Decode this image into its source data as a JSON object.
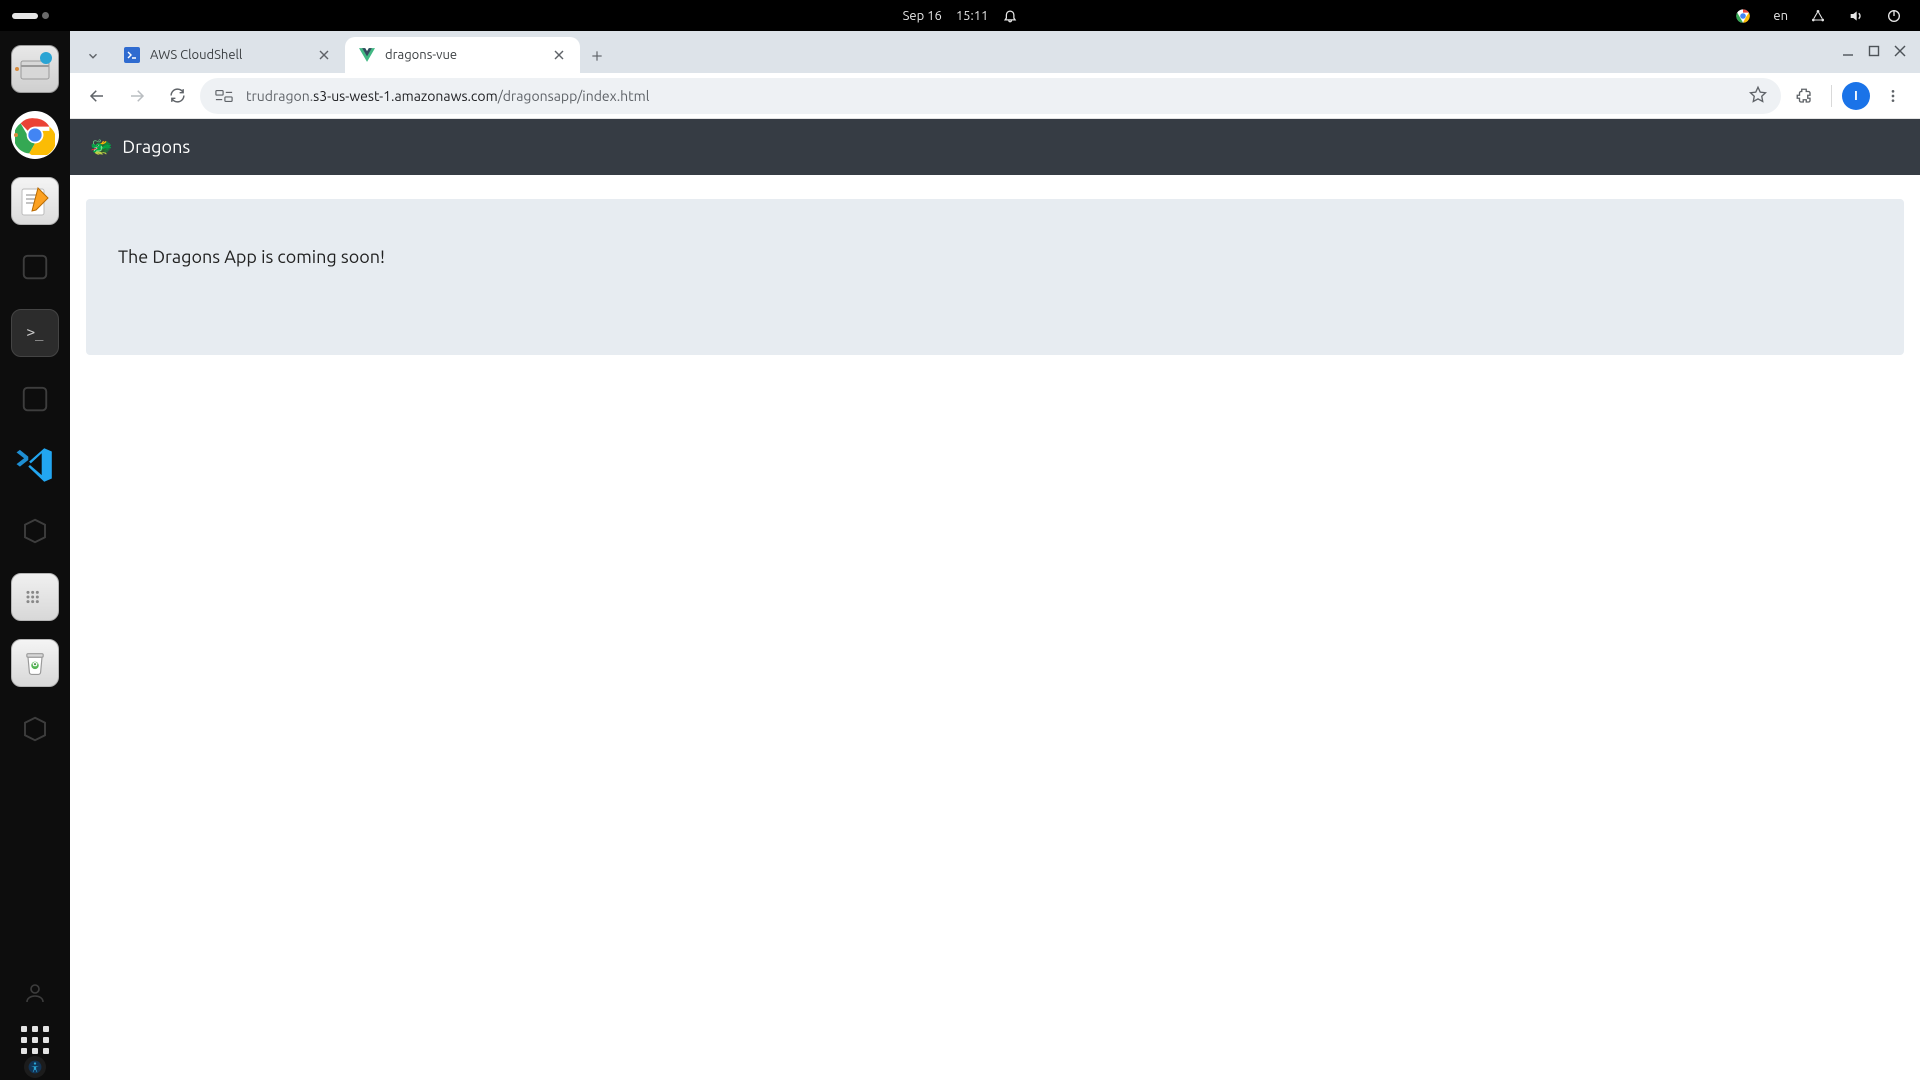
{
  "system": {
    "date": "Sep 16",
    "time": "15:11",
    "lang": "en"
  },
  "dock": {
    "files_badge": "1",
    "term_label": ">_"
  },
  "browser": {
    "tabs": [
      {
        "label": "AWS CloudShell",
        "active": false
      },
      {
        "label": "dragons-vue",
        "active": true
      }
    ],
    "url_host_prefix": "trudragon.",
    "url_host_main": "s3-us-west-1.amazonaws.com",
    "url_path": "/dragonsapp/index.html",
    "avatar_initial": "I"
  },
  "page": {
    "title": "Dragons",
    "emoji": "🐲",
    "message": "The Dragons App is coming soon!"
  }
}
